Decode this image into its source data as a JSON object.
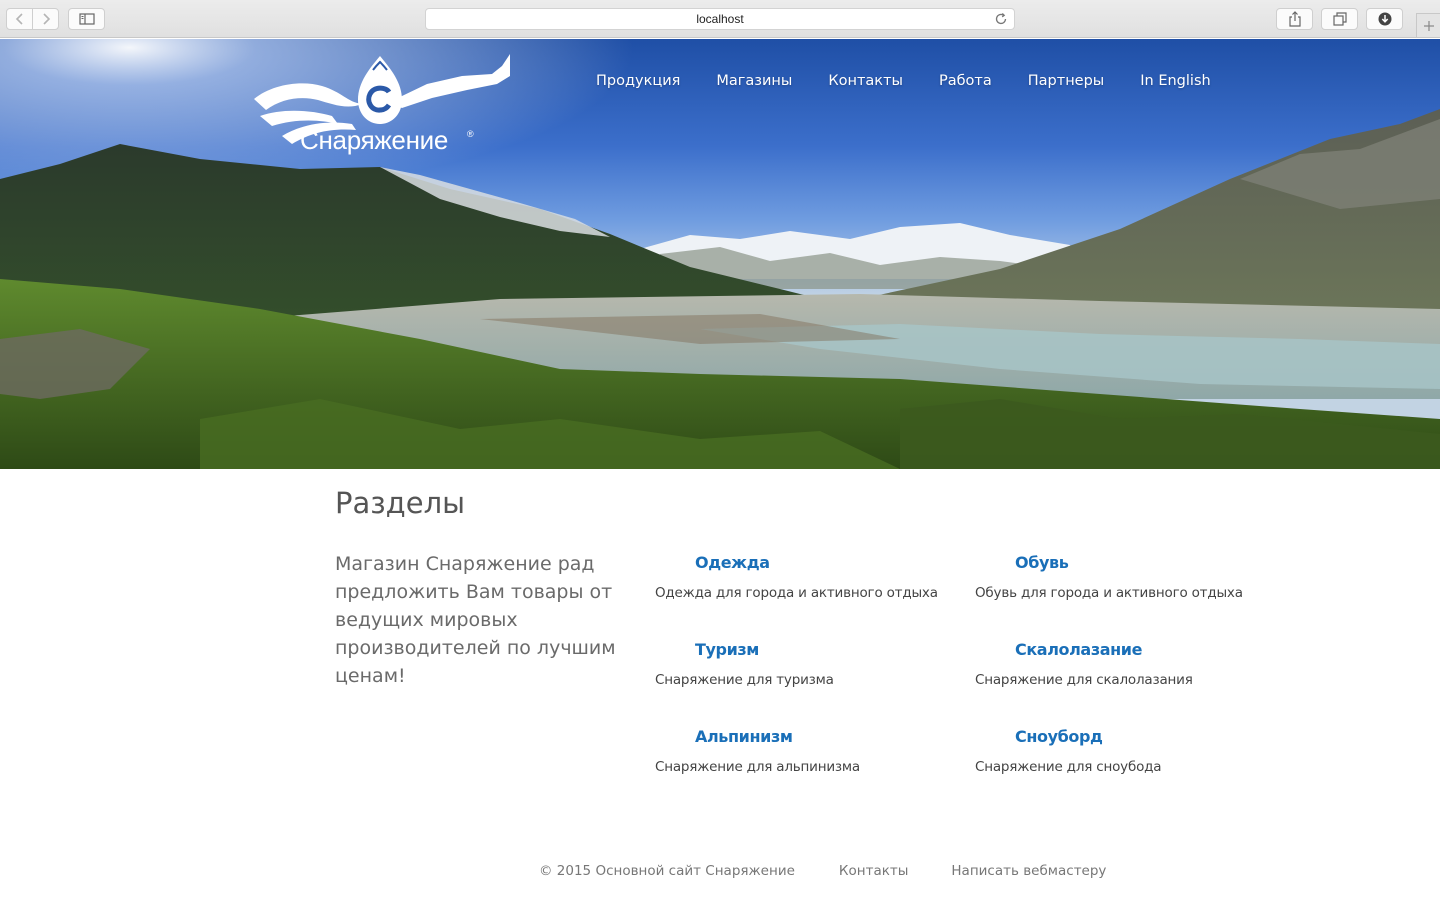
{
  "browser": {
    "address": "localhost",
    "icons": {
      "back": "chevron-left-icon",
      "forward": "chevron-right-icon",
      "sidebar": "sidebar-icon",
      "reload": "reload-icon",
      "share": "share-icon",
      "tabs": "tabs-icon",
      "downloads": "download-icon",
      "new_tab": "plus-icon"
    }
  },
  "header": {
    "logo_text": "Снаряжение",
    "logo_mark": "®",
    "nav": [
      {
        "label": "Продукция"
      },
      {
        "label": "Магазины"
      },
      {
        "label": "Контакты"
      },
      {
        "label": "Работа"
      },
      {
        "label": "Партнеры"
      },
      {
        "label": "In English"
      }
    ]
  },
  "main": {
    "title": "Разделы",
    "intro": "Магазин Снаряжение рад предложить Вам товары от ведущих мировых производителей по лучшим ценам!",
    "sections": [
      {
        "title": "Одежда",
        "description": "Одежда для города и активного отдыха"
      },
      {
        "title": "Обувь",
        "description": "Обувь для города и активного отдыха"
      },
      {
        "title": "Туризм",
        "description": "Снаряжение для туризма"
      },
      {
        "title": "Скалолазание",
        "description": "Снаряжение для скалолазания"
      },
      {
        "title": "Альпинизм",
        "description": "Снаряжение для альпинизма"
      },
      {
        "title": "Сноуборд",
        "description": "Снаряжение для сноубода"
      }
    ]
  },
  "footer": {
    "copyright": "© 2015 Основной сайт Снаряжение",
    "links": [
      {
        "label": "Контакты"
      },
      {
        "label": "Написать вебмастеру"
      }
    ]
  },
  "colors": {
    "link": "#1a6fb8",
    "heading": "#555555",
    "footer_text": "#777777"
  }
}
